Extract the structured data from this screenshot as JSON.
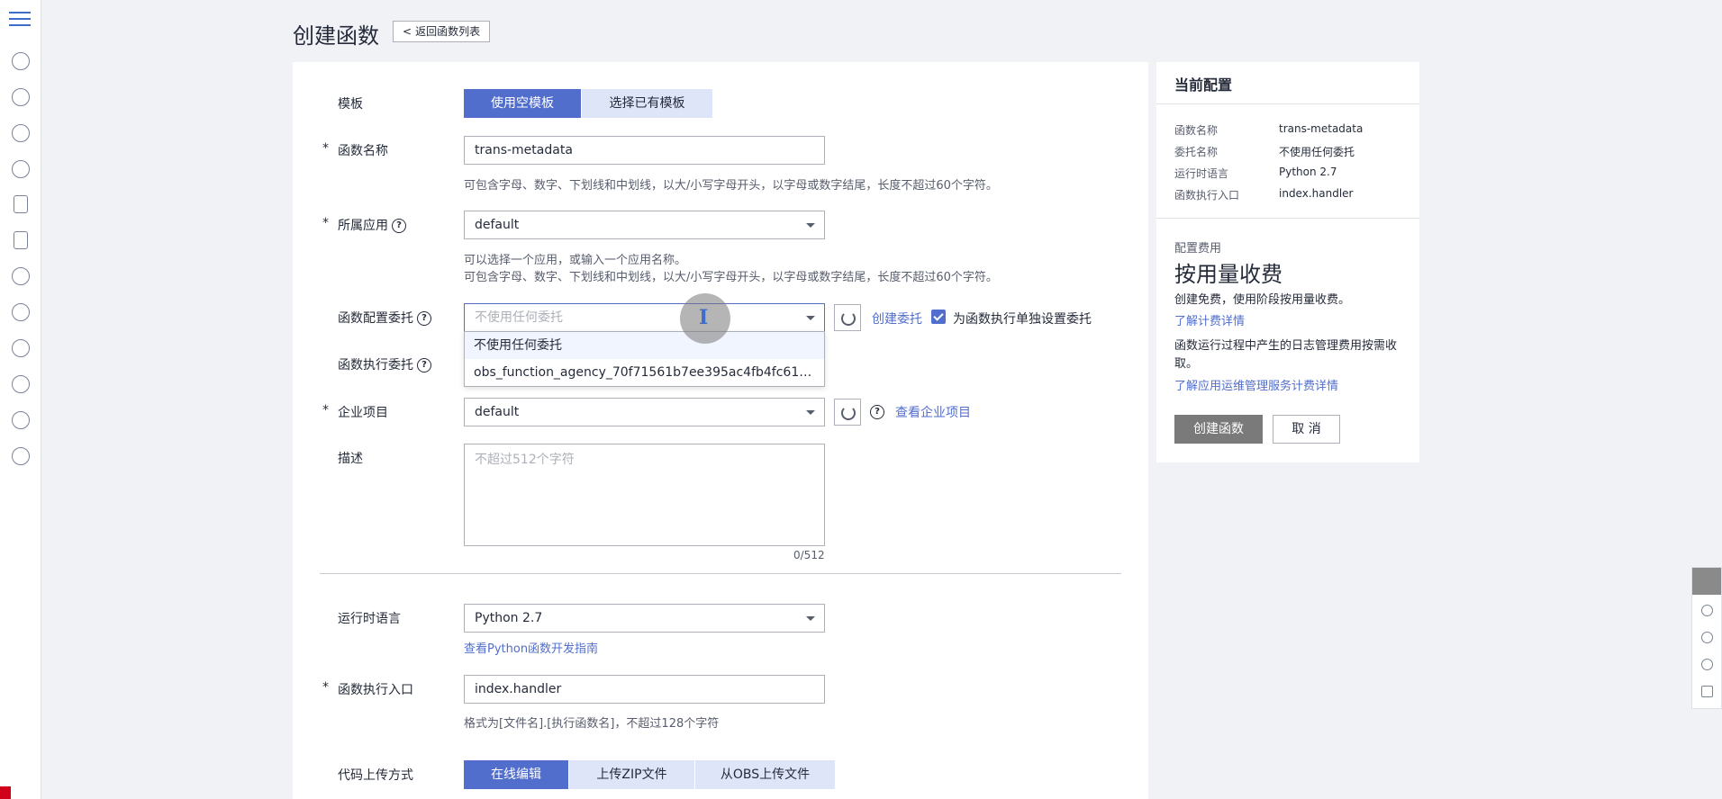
{
  "page": {
    "title": "创建函数",
    "back_label": "返回函数列表"
  },
  "form": {
    "template": {
      "label": "模板",
      "blank_button": "使用空模板",
      "existing_button": "选择已有模板"
    },
    "function_name": {
      "label": "函数名称",
      "value": "trans-metadata",
      "hint": "可包含字母、数字、下划线和中划线，以大/小写字母开头，以字母或数字结尾，长度不超过60个字符。"
    },
    "app": {
      "label": "所属应用",
      "value": "default",
      "hint1": "可以选择一个应用，或输入一个应用名称。",
      "hint2": "可包含字母、数字、下划线和中划线，以大/小写字母开头，以字母或数字结尾，长度不超过60个字符。"
    },
    "config_agency": {
      "label": "函数配置委托",
      "placeholder": "不使用任何委托",
      "create_link": "创建委托",
      "checkbox_label": "为函数执行单独设置委托",
      "options": [
        "不使用任何委托",
        "obs_function_agency_70f71561b7ee395ac4fb4fc61179..."
      ]
    },
    "exec_agency": {
      "label": "函数执行委托"
    },
    "enterprise_project": {
      "label": "企业项目",
      "value": "default",
      "view_link": "查看企业项目"
    },
    "description": {
      "label": "描述",
      "placeholder": "不超过512个字符",
      "counter": "0/512"
    },
    "runtime": {
      "label": "运行时语言",
      "value": "Python 2.7",
      "guide_link": "查看Python函数开发指南"
    },
    "handler": {
      "label": "函数执行入口",
      "value": "index.handler",
      "hint": "格式为[文件名].[执行函数名]，不超过128个字符"
    },
    "upload": {
      "label": "代码上传方式",
      "online": "在线编辑",
      "zip": "上传ZIP文件",
      "obs": "从OBS上传文件"
    },
    "required_mark": "*"
  },
  "summary": {
    "title": "当前配置",
    "rows": [
      {
        "key": "函数名称",
        "value": "trans-metadata"
      },
      {
        "key": "委托名称",
        "value": "不使用任何委托"
      },
      {
        "key": "运行时语言",
        "value": "Python 2.7"
      },
      {
        "key": "函数执行入口",
        "value": "index.handler"
      }
    ],
    "fee_label": "配置费用",
    "fee_type": "按用量收费",
    "fee_desc": "创建免费，使用阶段按用量收费。",
    "fee_link": "了解计费详情",
    "log_desc": "函数运行过程中产生的日志管理费用按需收取。",
    "log_link": "了解应用运维管理服务计费详情",
    "create_button": "创建函数",
    "cancel_button": "取 消"
  },
  "colors": {
    "primary": "#526ecc",
    "secondary": "#dfe5f8",
    "disabled_button": "#7a7a7a"
  }
}
